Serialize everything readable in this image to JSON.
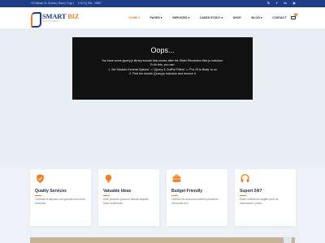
{
  "topbar": {
    "address": "20 Nassau St, Durban | Nava | Fopp |",
    "phone": "(+0074) 894 - 15587",
    "social": [
      "twitter",
      "facebook",
      "linkedin",
      "youtube"
    ]
  },
  "logo": {
    "word1": "SMART",
    "word2": "BIZ",
    "tagline": "SOLUTIONS"
  },
  "nav": {
    "items": [
      "HOME",
      "PAGES",
      "SERVICES",
      "CASES STUDY",
      "SHOP",
      "BLOG",
      "CONTACT"
    ],
    "active": "HOME",
    "cart_count": "0"
  },
  "error": {
    "title": "Oops...",
    "lines": [
      "You have some jquery.js library include that comes after the Slider Revolution files js inclusion.",
      "To fix this, you can:",
      "1. Set 'Module General Options' -> 'jQuery & OutPut Filters' -> 'Put JS to Body' to on",
      "2. Find the double jQuery.js inclusion and remove it"
    ]
  },
  "cards": [
    {
      "icon": "shield-check-icon",
      "title": "Quality Services",
      "desc": "Conubia et aliquam cub gravida sed morbi accumsa."
    },
    {
      "icon": "lightbulb-icon",
      "title": "Valuable Ideas",
      "desc": "Ante pharetra posuere blandit aliquam fusce sollicitudin."
    },
    {
      "icon": "briefcase-icon",
      "title": "Budget Friendly",
      "desc": "Lacinia nisl accumsa sceleris phasellus venenatis don."
    },
    {
      "icon": "headset-icon",
      "title": "Suport 24/7",
      "desc": "Etiam sollicitudin sagittis justo at ullamcorper potent."
    }
  ],
  "colors": {
    "primary": "#1d3d86",
    "accent": "#f47e20",
    "text": "#1b2a45"
  }
}
